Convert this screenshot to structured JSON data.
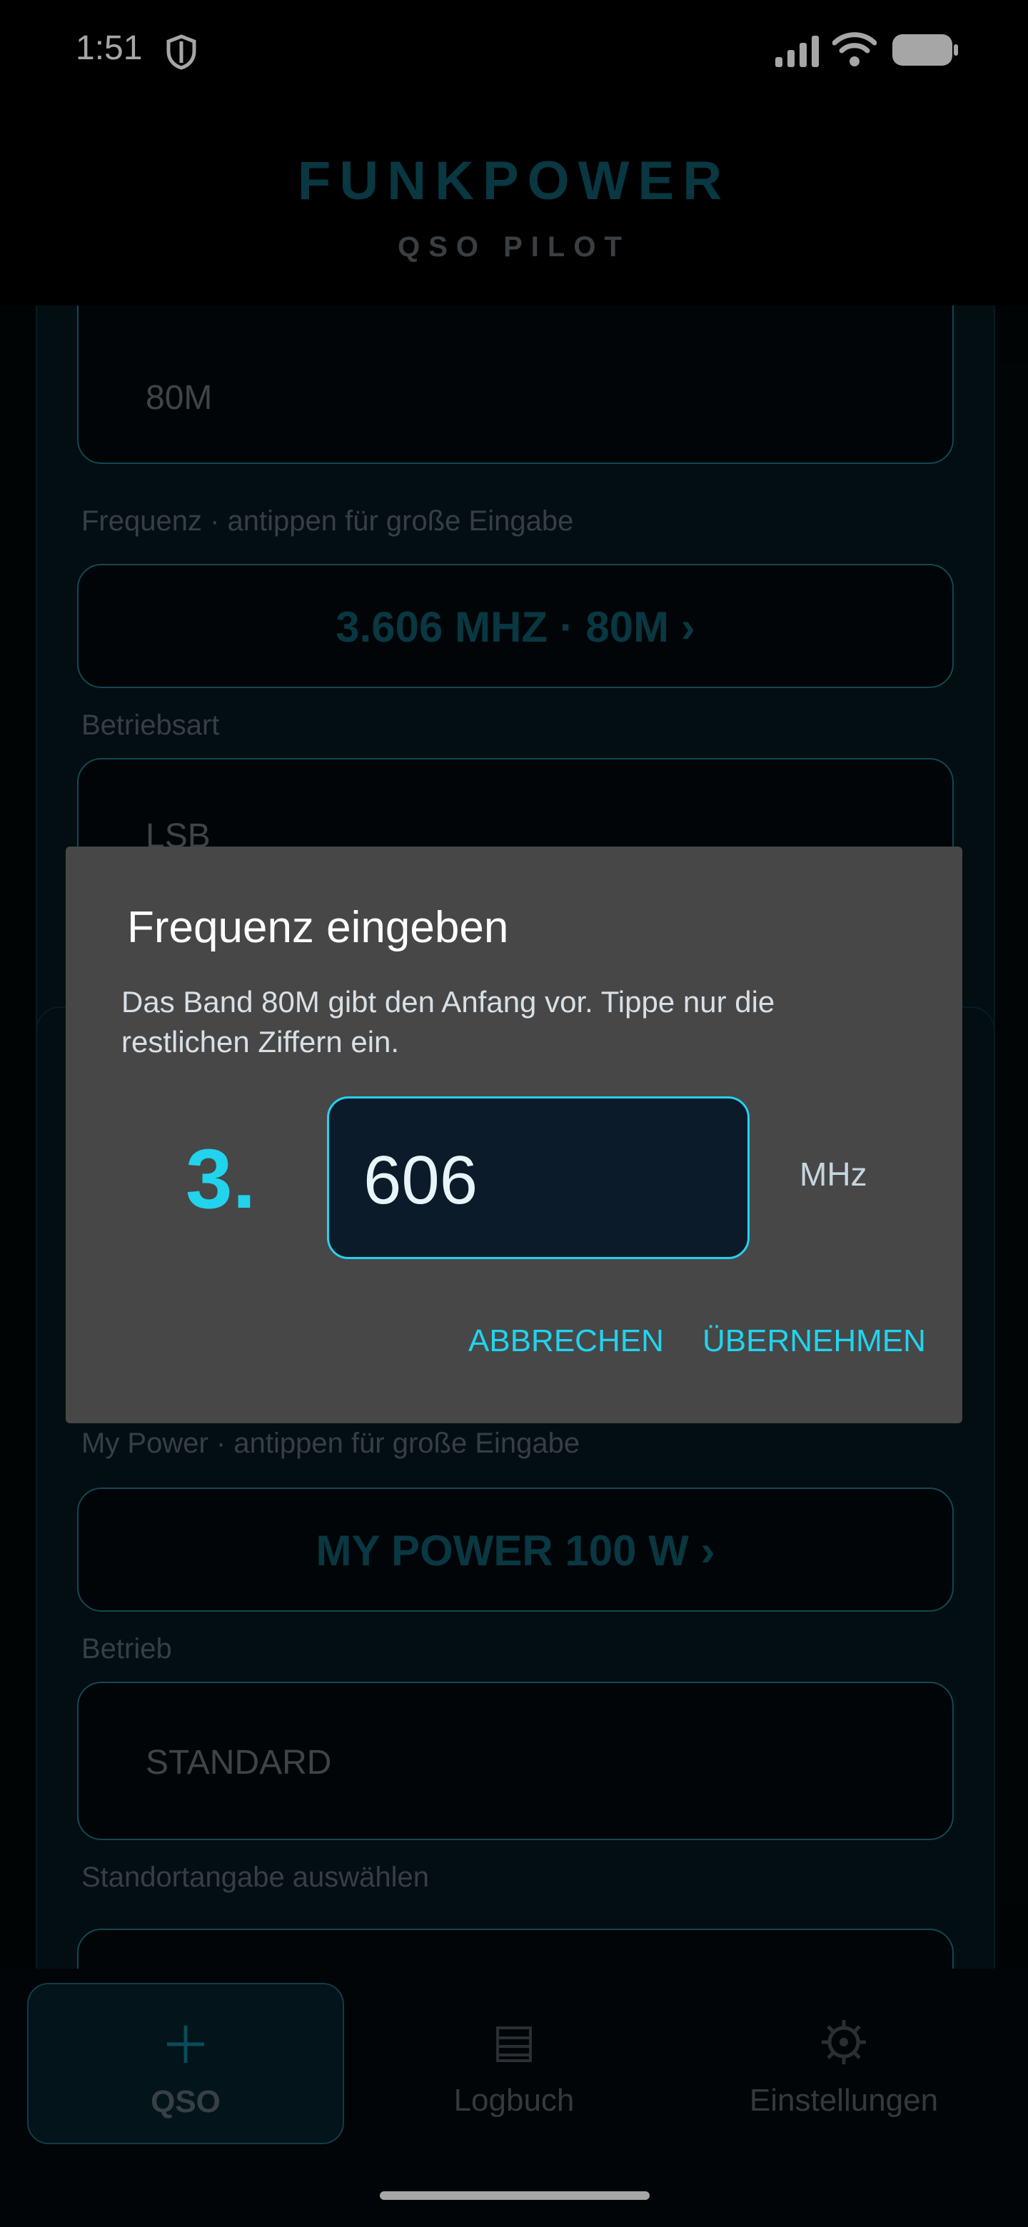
{
  "status_bar": {
    "time": "1:51"
  },
  "header": {
    "title": "FUNKPOWER",
    "subtitle": "QSO PILOT"
  },
  "form": {
    "band_value": "80M",
    "frequency_label": "Frequenz · antippen für große Eingabe",
    "frequency_value": "3.606 MHZ   ·   80M   ›",
    "mode_label": "Betriebsart",
    "mode_value": "LSB",
    "power_label": "My Power · antippen für große Eingabe",
    "power_value": "MY POWER    100 W   ›",
    "operation_label": "Betrieb",
    "operation_value": "STANDARD",
    "location_label": "Standortangabe auswählen"
  },
  "dialog": {
    "title": "Frequenz eingeben",
    "message": "Das Band 80M gibt den Anfang vor. Tippe nur die restlichen Ziffern ein.",
    "prefix": "3.",
    "input_value": "606",
    "unit": "MHz",
    "cancel_label": "ABBRECHEN",
    "confirm_label": "ÜBERNEHMEN"
  },
  "nav": {
    "items": [
      {
        "label": "QSO",
        "icon": "plus-icon"
      },
      {
        "label": "Logbuch",
        "icon": "list-icon"
      },
      {
        "label": "Einstellungen",
        "icon": "gear-icon"
      }
    ]
  }
}
